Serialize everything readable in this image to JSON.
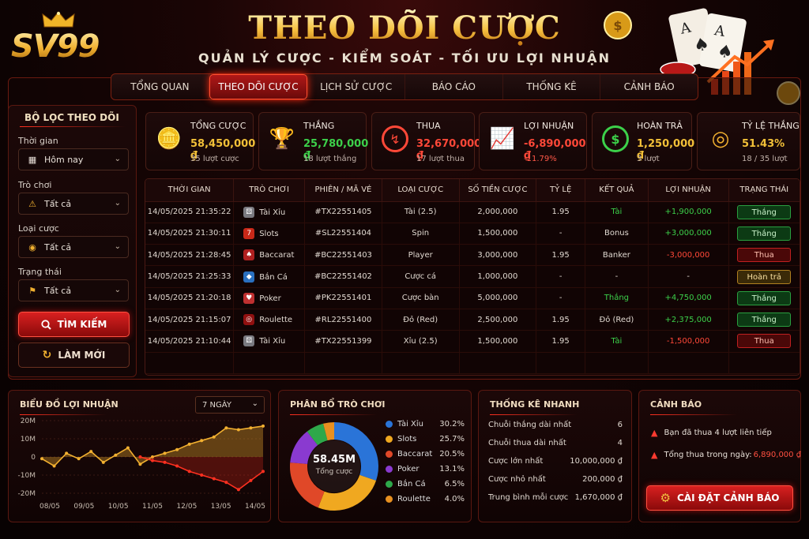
{
  "brand": {
    "logo_text": "SV99"
  },
  "header": {
    "title": "THEO DÕI CƯỢC",
    "subtitle": "QUẢN LÝ CƯỢC - KIỂM SOÁT - TỐI ƯU LỢI NHUẬN"
  },
  "tabs": [
    {
      "label": "TỔNG QUAN"
    },
    {
      "label": "THEO DÕI CƯỢC"
    },
    {
      "label": "LỊCH SỬ CƯỢC"
    },
    {
      "label": "BÁO CÁO"
    },
    {
      "label": "THỐNG KÊ"
    },
    {
      "label": "CẢNH BÁO"
    }
  ],
  "filter": {
    "title": "BỘ LỌC THEO DÕI",
    "time_label": "Thời gian",
    "time_value": "Hôm nay",
    "game_label": "Trò chơi",
    "game_value": "Tất cả",
    "bet_label": "Loại cược",
    "bet_value": "Tất cả",
    "status_label": "Trạng thái",
    "status_value": "Tất cả",
    "search_button": "TÌM KIẾM",
    "refresh_button": "LÀM MỚI"
  },
  "stats": [
    {
      "label": "TỔNG CƯỢC",
      "value": "58,450,000 ₫",
      "sub": "35 lượt cược",
      "color": "#f2c038",
      "icon": "coins-icon"
    },
    {
      "label": "THẮNG",
      "value": "25,780,000 ₫",
      "sub": "18 lượt thắng",
      "color": "#3cd04a",
      "icon": "trophy-icon"
    },
    {
      "label": "THUA",
      "value": "32,670,000 ₫",
      "sub": "17 lượt thua",
      "color": "#ff4838",
      "icon": "loss-icon"
    },
    {
      "label": "LỢI NHUẬN",
      "value": "-6,890,000 ₫",
      "sub": "-11.79%",
      "color": "#ff4838",
      "icon": "profit-chart-icon"
    },
    {
      "label": "HOÀN TRẢ",
      "value": "1,250,000 ₫",
      "sub": "3 lượt",
      "color": "#f2c038",
      "icon": "refund-icon"
    },
    {
      "label": "TỶ LỆ THẮNG",
      "value": "51.43%",
      "sub": "18 / 35 lượt",
      "color": "#f2c038",
      "icon": "target-icon"
    }
  ],
  "table": {
    "headers": [
      "THỜI GIAN",
      "TRÒ CHƠI",
      "PHIÊN / MÃ VÉ",
      "LOẠI CƯỢC",
      "SỐ TIỀN CƯỢC",
      "TỶ LỆ",
      "KẾT QUẢ",
      "LỢI NHUẬN",
      "TRẠNG THÁI"
    ],
    "rows": [
      {
        "time": "14/05/2025 21:35:22",
        "game": "Tài Xỉu",
        "ticket": "#TX22551405",
        "bet": "Tài (2.5)",
        "amount": "2,000,000",
        "odds": "1.95",
        "result": "Tài",
        "profit": "+1,900,000",
        "status": "Thắng",
        "icon": "dice-icon",
        "icolor": "#7a7a80"
      },
      {
        "time": "14/05/2025 21:30:11",
        "game": "Slots",
        "ticket": "#SL22551404",
        "bet": "Spin",
        "amount": "1,500,000",
        "odds": "-",
        "result": "Bonus",
        "profit": "+3,000,000",
        "status": "Thắng",
        "icon": "slots-icon",
        "icolor": "#c82818"
      },
      {
        "time": "14/05/2025 21:28:45",
        "game": "Baccarat",
        "ticket": "#BC22551403",
        "bet": "Player",
        "amount": "3,000,000",
        "odds": "1.95",
        "result": "Banker",
        "profit": "-3,000,000",
        "status": "Thua",
        "icon": "cards-icon",
        "icolor": "#b02020"
      },
      {
        "time": "14/05/2025 21:25:33",
        "game": "Bắn Cá",
        "ticket": "#BC22551402",
        "bet": "Cược cá",
        "amount": "1,000,000",
        "odds": "-",
        "result": "-",
        "profit": "-",
        "status": "Hoàn trả",
        "icon": "fish-icon",
        "icolor": "#2a70c0"
      },
      {
        "time": "14/05/2025 21:20:18",
        "game": "Poker",
        "ticket": "#PK22551401",
        "bet": "Cược bàn",
        "amount": "5,000,000",
        "odds": "-",
        "result": "Thắng",
        "profit": "+4,750,000",
        "status": "Thắng",
        "icon": "poker-icon",
        "icolor": "#c03030"
      },
      {
        "time": "14/05/2025 21:15:07",
        "game": "Roulette",
        "ticket": "#RL22551400",
        "bet": "Đỏ (Red)",
        "amount": "2,500,000",
        "odds": "1.95",
        "result": "Đỏ (Red)",
        "profit": "+2,375,000",
        "status": "Thắng",
        "icon": "roulette-icon",
        "icolor": "#901010"
      },
      {
        "time": "14/05/2025 21:10:44",
        "game": "Tài Xỉu",
        "ticket": "#TX22551399",
        "bet": "Xỉu (2.5)",
        "amount": "1,500,000",
        "odds": "1.95",
        "result": "Tài",
        "profit": "-1,500,000",
        "status": "Thua",
        "icon": "dice-icon",
        "icolor": "#7a7a80"
      }
    ]
  },
  "profit_panel": {
    "title": "BIỂU ĐỒ LỢI NHUẬN",
    "range_select": "7 NGÀY"
  },
  "chart_data": {
    "type": "area",
    "title": "BIỂU ĐỒ LỢI NHUẬN",
    "x_ticks": [
      "08/05",
      "09/05",
      "10/05",
      "11/05",
      "12/05",
      "13/05",
      "14/05"
    ],
    "y_ticks": [
      "20M",
      "10M",
      "0",
      "-10M",
      "-20M"
    ],
    "ylim": [
      -20,
      20
    ],
    "series": [
      {
        "values": [
          -1,
          -5,
          2,
          -1,
          3,
          -3,
          1,
          5,
          -4,
          0,
          2,
          4,
          7,
          9,
          11,
          16,
          15,
          16,
          17
        ],
        "color": "#f2b030"
      },
      {
        "values": [
          null,
          null,
          null,
          null,
          null,
          null,
          null,
          null,
          0,
          -2,
          -3,
          -5,
          -8,
          -10,
          -12,
          -14,
          -18,
          -13,
          -8
        ],
        "color": "#ff3020"
      }
    ]
  },
  "dist_panel": {
    "title": "PHÂN BỔ TRÒ CHƠI",
    "center_value": "58.45M",
    "center_label": "Tổng cược"
  },
  "game_distribution": [
    {
      "name": "Tài Xỉu",
      "pct": "30.2%",
      "value": 30.2,
      "color": "#2a74d8"
    },
    {
      "name": "Slots",
      "pct": "25.7%",
      "value": 25.7,
      "color": "#f0a820"
    },
    {
      "name": "Baccarat",
      "pct": "20.5%",
      "value": 20.5,
      "color": "#e04828"
    },
    {
      "name": "Poker",
      "pct": "13.1%",
      "value": 13.1,
      "color": "#8a3ad0"
    },
    {
      "name": "Bắn Cá",
      "pct": "6.5%",
      "value": 6.5,
      "color": "#2ea84a"
    },
    {
      "name": "Roulette",
      "pct": "4.0%",
      "value": 4.0,
      "color": "#e89020"
    }
  ],
  "quick_stats": {
    "title": "THỐNG KÊ NHANH",
    "rows": [
      {
        "label": "Chuỗi thắng dài nhất",
        "value": "6"
      },
      {
        "label": "Chuỗi thua dài nhất",
        "value": "4"
      },
      {
        "label": "Cược lớn nhất",
        "value": "10,000,000 ₫"
      },
      {
        "label": "Cược nhỏ nhất",
        "value": "200,000 ₫"
      },
      {
        "label": "Trung bình mỗi cược",
        "value": "1,670,000 ₫"
      }
    ]
  },
  "alerts": {
    "title": "CẢNH BÁO",
    "items": [
      {
        "text": "Bạn đã thua 4 lượt liên tiếp",
        "highlight": ""
      },
      {
        "text": "Tổng thua trong ngày: ",
        "highlight": "6,890,000 ₫"
      }
    ],
    "button": "CÀI ĐẶT CẢNH BÁO"
  }
}
